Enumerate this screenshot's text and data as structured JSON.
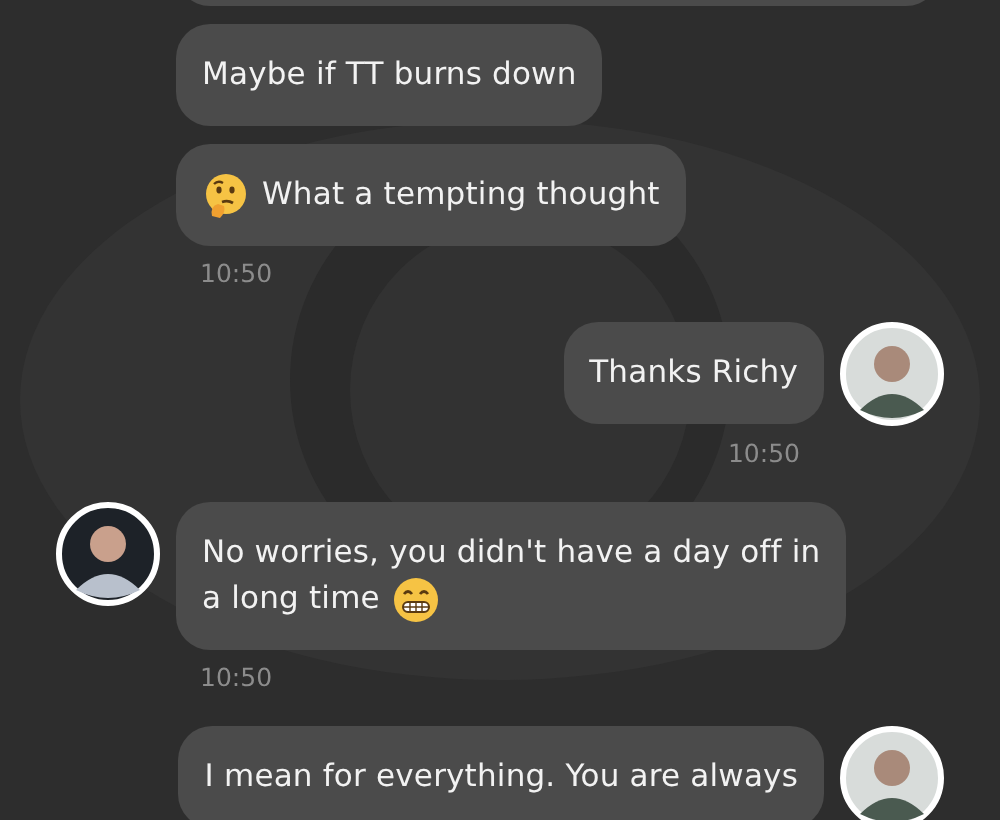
{
  "messages": [
    {
      "kind": "incoming",
      "avatar": false,
      "lines": [
        [
          {
            "kind": "text",
            "text": "Maybe if TT burns down"
          }
        ]
      ]
    },
    {
      "kind": "incoming",
      "avatar": false,
      "lines": [
        [
          {
            "kind": "thinking-emoji"
          },
          {
            "kind": "text",
            "text": "What a tempting thought"
          }
        ]
      ],
      "time": "10:50"
    },
    {
      "kind": "outgoing",
      "avatar": true,
      "lines": [
        [
          {
            "kind": "text",
            "text": "Thanks Richy"
          }
        ]
      ],
      "time": "10:50"
    },
    {
      "kind": "incoming",
      "avatar": true,
      "lines": [
        [
          {
            "kind": "text",
            "text": "No worries, you didn't have a day off in"
          }
        ],
        [
          {
            "kind": "text",
            "text": "a long time"
          },
          {
            "kind": "grin-emoji"
          }
        ]
      ],
      "time": "10:50"
    },
    {
      "kind": "outgoing",
      "avatar": true,
      "lines": [
        [
          {
            "kind": "text",
            "text": "I mean for everything. You are always"
          }
        ]
      ]
    }
  ]
}
